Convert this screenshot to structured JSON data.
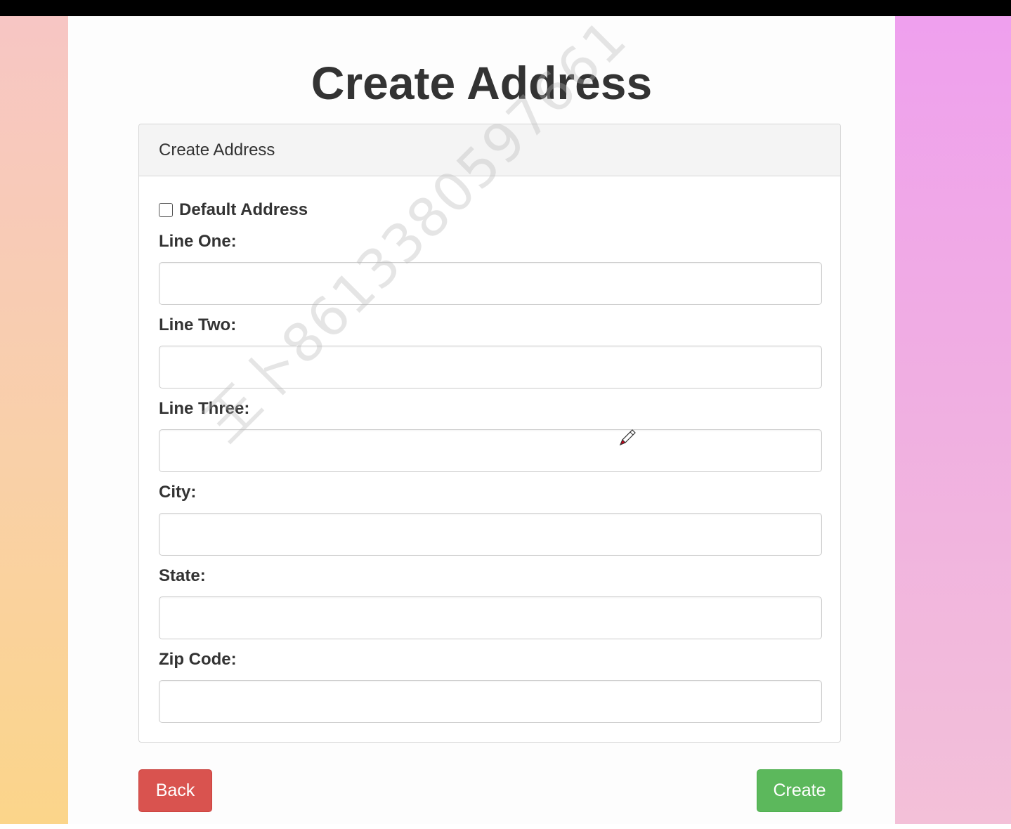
{
  "page": {
    "title": "Create Address"
  },
  "panel": {
    "heading": "Create Address"
  },
  "form": {
    "default_address": {
      "label": "Default Address",
      "checked": false
    },
    "fields": {
      "line_one": {
        "label": "Line One:",
        "value": "",
        "placeholder": ""
      },
      "line_two": {
        "label": "Line Two:",
        "value": "",
        "placeholder": ""
      },
      "line_three": {
        "label": "Line Three:",
        "value": "",
        "placeholder": ""
      },
      "city": {
        "label": "City:",
        "value": "",
        "placeholder": ""
      },
      "state": {
        "label": "State:",
        "value": "",
        "placeholder": ""
      },
      "zip_code": {
        "label": "Zip Code:",
        "value": "",
        "placeholder": ""
      }
    }
  },
  "buttons": {
    "back_label": "Back",
    "create_label": "Create"
  },
  "watermark": {
    "text": "王卜8613380597661"
  },
  "colors": {
    "back": "#d9534f",
    "create": "#5cb85c",
    "title_text": "#333333"
  },
  "icons": {
    "cursor": "pen-cursor-icon"
  }
}
